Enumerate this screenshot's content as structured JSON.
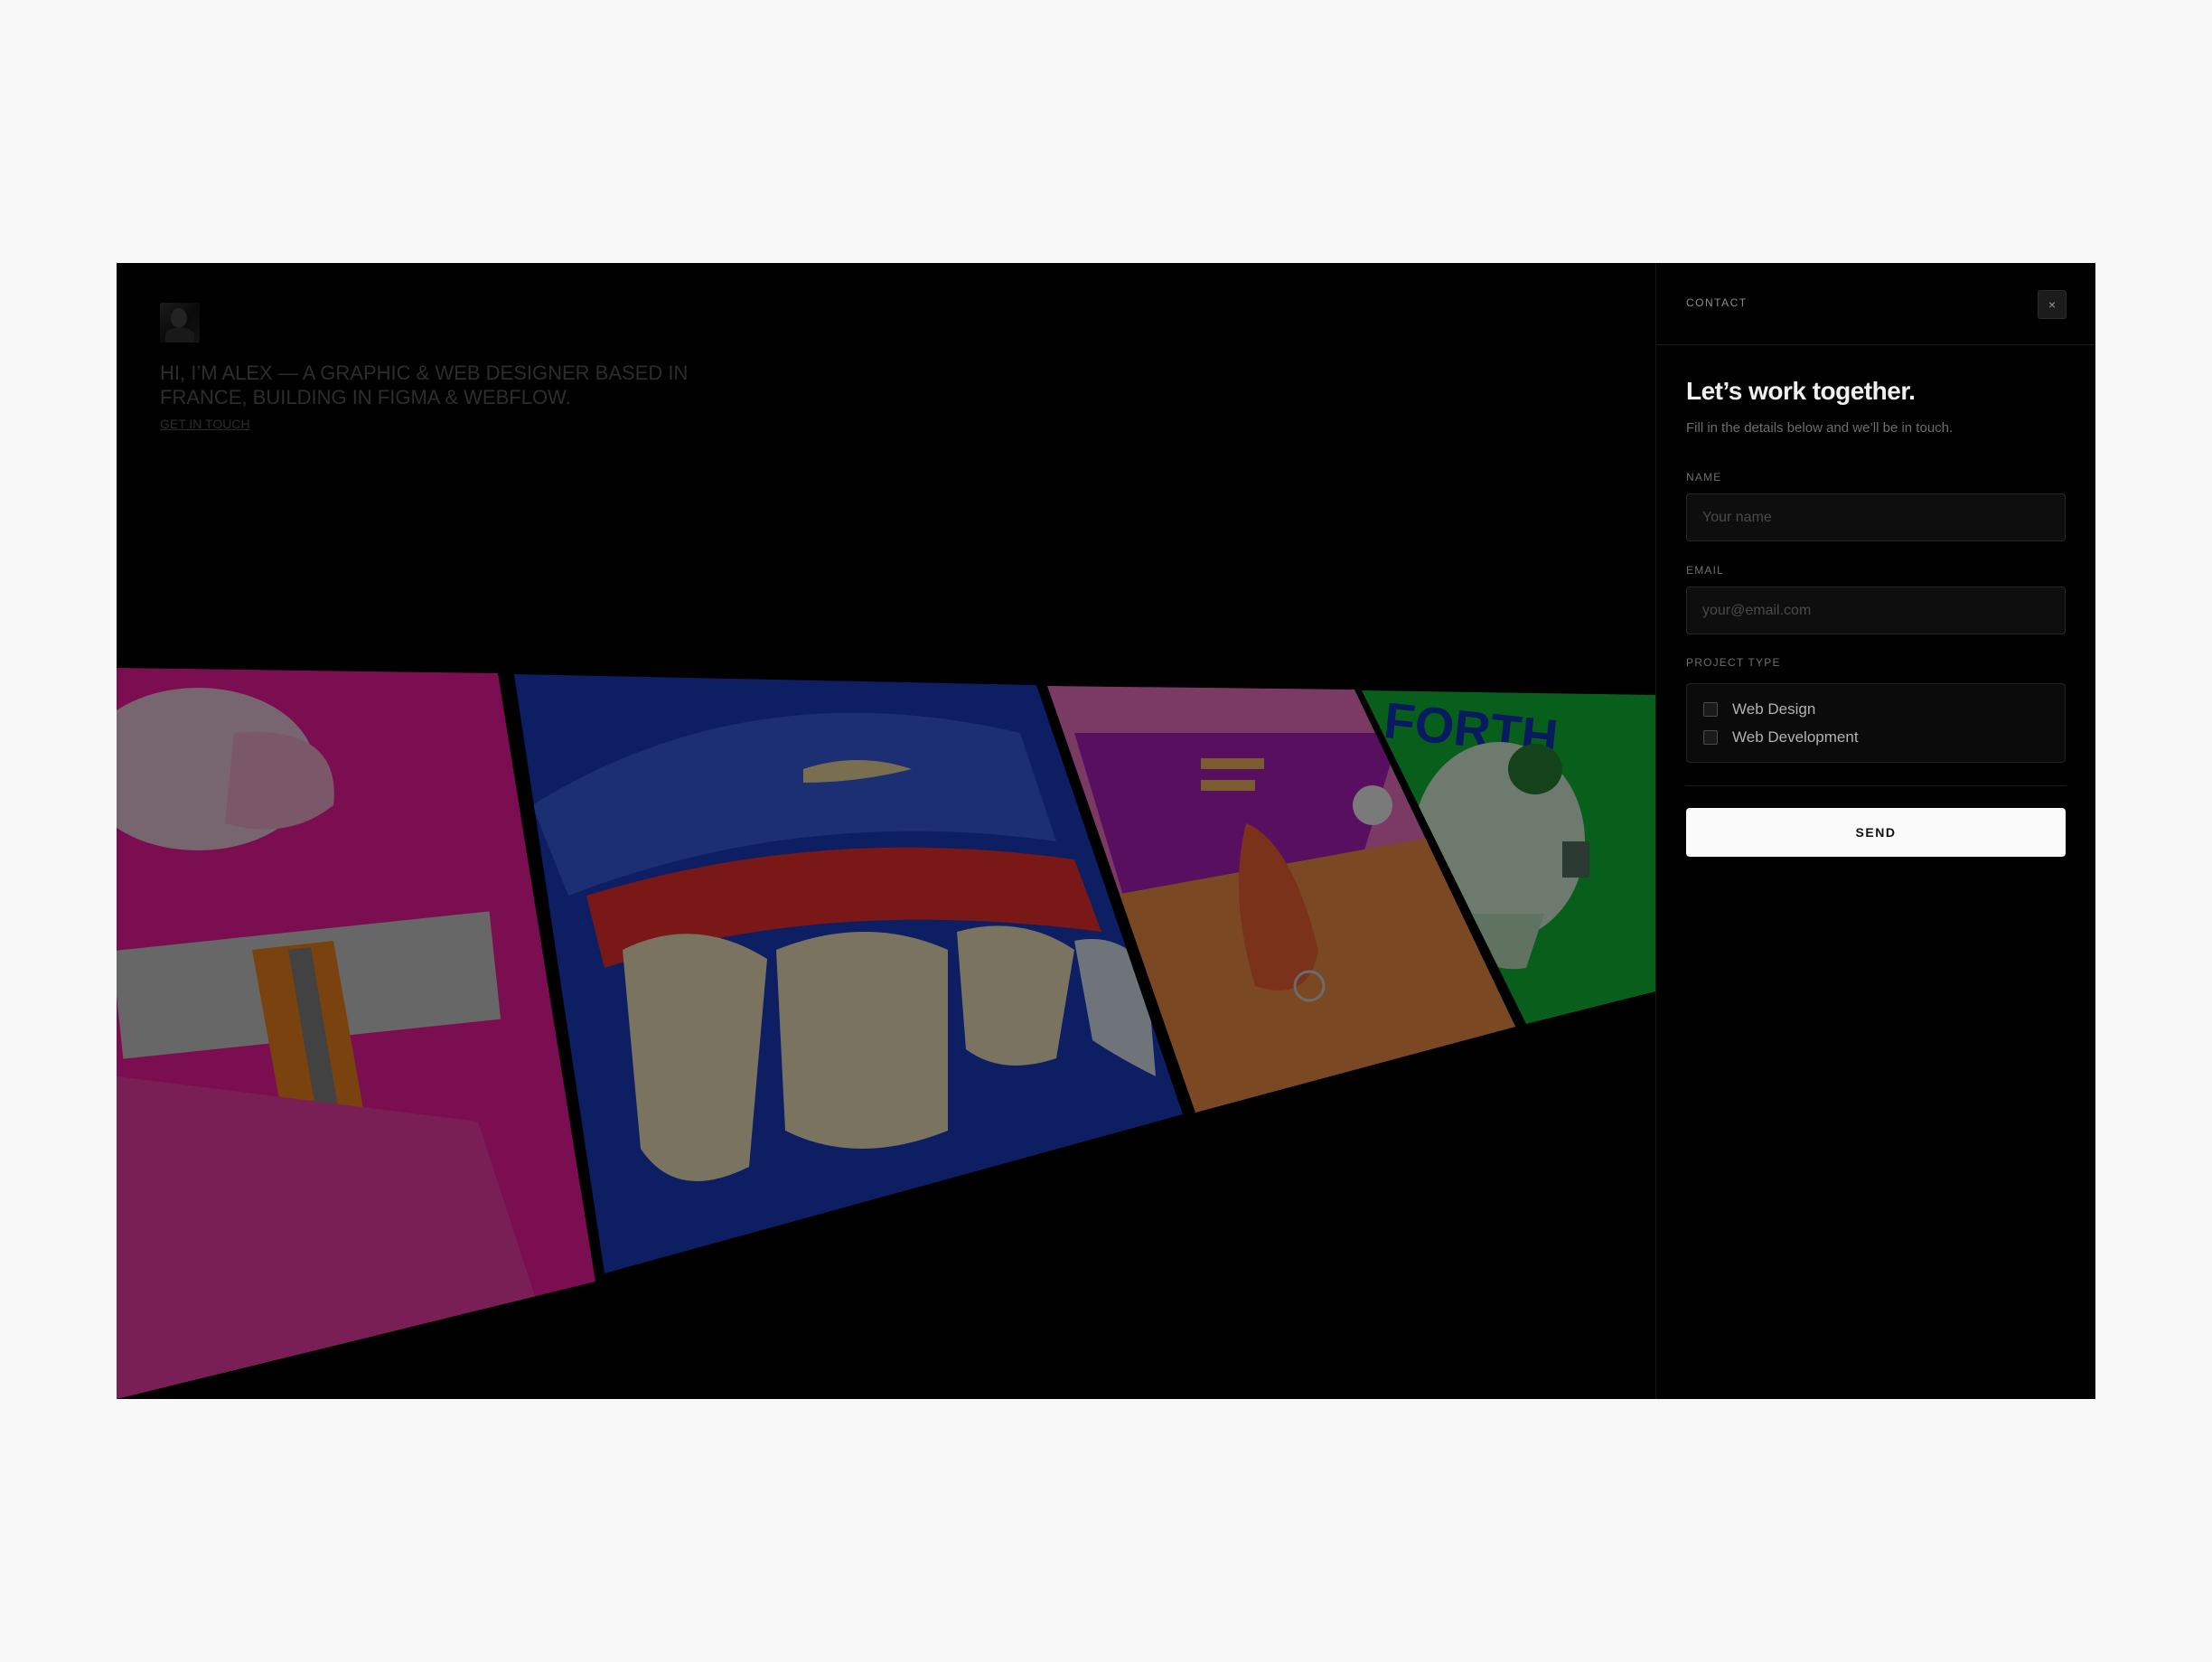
{
  "site": {
    "intro": "HI, I’M ALEX — A GRAPHIC & WEB DESIGNER BASED IN FRANCE, BUILDING IN FIGMA & WEBFLOW.",
    "cta_link": "GET IN TOUCH",
    "artwork_logo_text": "FORTH"
  },
  "contact_panel": {
    "title": "CONTACT",
    "close_icon": "×",
    "heading": "Let’s work together.",
    "subheading": "Fill in the details below and we’ll be in touch.",
    "fields": {
      "name": {
        "label": "NAME",
        "placeholder": "Your name",
        "value": ""
      },
      "email": {
        "label": "EMAIL",
        "placeholder": "your@email.com",
        "value": ""
      }
    },
    "project_type": {
      "label": "PROJECT TYPE",
      "options": [
        {
          "label": "Web Design",
          "checked": false
        },
        {
          "label": "Web Development",
          "checked": false
        }
      ]
    },
    "submit_label": "SEND"
  },
  "colors": {
    "page_background": "#f8f8f8",
    "panel_background": "#000000",
    "button_background": "#fafafa",
    "artwork_magenta": "#ff1ea8",
    "artwork_blue": "#2448d8",
    "artwork_green": "#11c63c"
  }
}
